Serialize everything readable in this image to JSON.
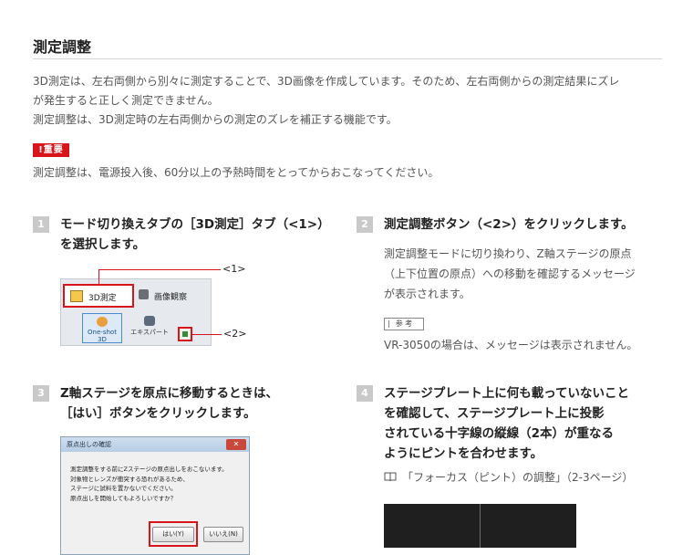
{
  "section": {
    "title": "測定調整",
    "intro": [
      "3D測定は、左右両側から別々に測定することで、3D画像を作成しています。そのため、左右両側からの測定結果にズレ",
      "が発生すると正しく測定できません。",
      "測定調整は、3D測定時の左右両側からの測定のズレを補正する機能です。"
    ],
    "important_label": "重要",
    "important_text": "測定調整は、電源投入後、60分以上の予熱時間をとってからおこなってください。"
  },
  "steps": [
    {
      "number": "1",
      "heading": [
        "モード切り換えタブの［3D測定］タブ（<1>）",
        "を選択します。"
      ],
      "screenshot": {
        "tab_3d": "3D測定",
        "tab_observe": "画像観察",
        "oneshot": "One-shot 3D",
        "expert": "エキスパート",
        "callout1": "<1>",
        "callout2": "<2>"
      }
    },
    {
      "number": "2",
      "heading": [
        "測定調整ボタン（<2>）をクリックします。"
      ],
      "body": [
        "測定調整モードに切り換わり、Z軸ステージの原点",
        "（上下位置の原点）への移動を確認するメッセージ",
        "が表示されます。"
      ],
      "ref_label": "参 考",
      "ref_text": "VR-3050の場合は、メッセージは表示されません。"
    },
    {
      "number": "3",
      "heading": [
        "Z軸ステージを原点に移動するときは、",
        "［はい］ボタンをクリックします。"
      ],
      "dialog": {
        "title": "原点出しの確認",
        "close": "✕",
        "lines": [
          "測定調整をする前にZステージの原点出しをおこないます。",
          "対象物とレンズが衝突する恐れがあるため、",
          "ステージに試料を置かないでください。",
          "原点出しを開始してもよろしいですか？"
        ],
        "yes": "はい(Y)",
        "no": "いいえ(N)"
      }
    },
    {
      "number": "4",
      "heading": [
        "ステージプレート上に何も載っていないこと",
        "を確認して、ステージプレート上に投影",
        "されている十字線の縦線（2本）が重なる",
        "ようにピントを合わせます。"
      ],
      "ref_text": "「フォーカス（ピント）の調整」（2-3ページ）"
    }
  ],
  "colors": {
    "accent_red": "#d8151b",
    "step_badge_gray": "#c9c9c9"
  }
}
